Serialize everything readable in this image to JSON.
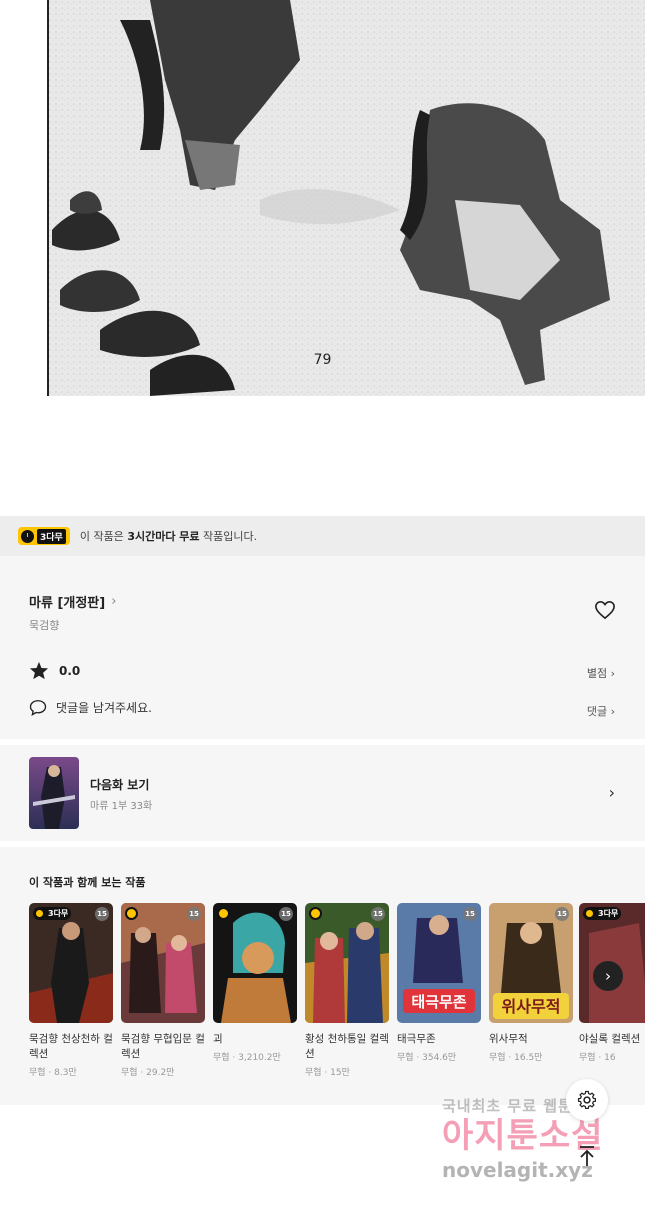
{
  "comic": {
    "page_number": "79"
  },
  "free_banner": {
    "badge": "3다무",
    "text_before": "이 작품은 ",
    "text_bold": "3시간마다 무료",
    "text_after": " 작품입니다."
  },
  "series": {
    "title": "마류 [개정판]",
    "author": "묵검향",
    "rating": "0.0",
    "rating_link": "별점",
    "comment_placeholder": "댓글을 남겨주세요.",
    "comment_link": "댓글"
  },
  "next_episode": {
    "title": "다음화 보기",
    "subtitle": "마류 1부 33화"
  },
  "related": {
    "heading": "이 작품과 함께 보는 작품",
    "items": [
      {
        "name": "묵검향 천상천하 컬렉션",
        "meta": "무협 · 8.3만",
        "age": "15",
        "free3": true
      },
      {
        "name": "묵검향 무협입문 컬렉션",
        "meta": "무협 · 29.2만",
        "age": "15",
        "free3": false
      },
      {
        "name": "괴",
        "meta": "무협 · 3,210.2만",
        "age": "15",
        "free3": false
      },
      {
        "name": "황성 천하통일 컬렉션",
        "meta": "무협 · 15만",
        "age": "15",
        "free3": false
      },
      {
        "name": "태극무존",
        "meta": "무협 · 354.6만",
        "age": "15",
        "free3": false
      },
      {
        "name": "위사무적",
        "meta": "무협 · 16.5만",
        "age": "15",
        "free3": false
      },
      {
        "name": "야실록 컬렉션",
        "meta": "무협 · 16",
        "age": "",
        "free3": true
      }
    ],
    "free_tag": "3다무"
  },
  "watermark": {
    "line1": "국내최초 무료 웹툰",
    "line2": "아지툰소설",
    "line3": "novelagit.xyz"
  },
  "colors": {
    "accent_yellow": "#ffc500",
    "panel_bg": "#f6f6f6",
    "banner_bg": "#ededed"
  }
}
